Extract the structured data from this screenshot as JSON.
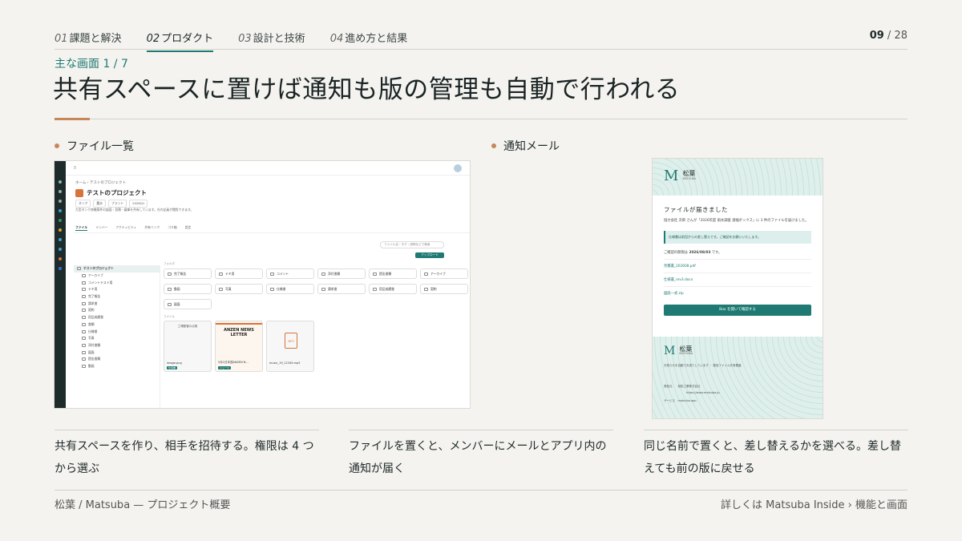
{
  "nav": {
    "items": [
      {
        "num": "01",
        "label": "課題と解決"
      },
      {
        "num": "02",
        "label": "プロダクト"
      },
      {
        "num": "03",
        "label": "設計と技術"
      },
      {
        "num": "04",
        "label": "進め方と結果"
      }
    ],
    "active_index": 1
  },
  "page": {
    "current": "09",
    "separator": "/",
    "total": "28"
  },
  "eyebrow": "主な画面 1 / 7",
  "title": "共有スペースに置けば通知も版の管理も自動で行われる",
  "sections": {
    "left_label": "ファイル一覧",
    "right_label": "通知メール"
  },
  "app": {
    "breadcrumb": "ホーム › テストのプロジェクト",
    "project_name": "テストのプロジェクト",
    "chips": [
      "タンク",
      "農水",
      "プラント",
      "2026Q1"
    ],
    "description": "大型タンク修繕案件の図面・見積・議事を共有しています。社内全員が閲覧できます。",
    "tabs": [
      "ファイル",
      "メンバー",
      "アクティビティ",
      "共有リンク",
      "ゴミ箱",
      "設定"
    ],
    "search_placeholder": "ファイル名・タグ・説明などで検索",
    "upload_label": "アップロード",
    "tree_root": "テストのプロジェクト",
    "tree": [
      "アーカイブ",
      "コメントテスト用",
      "テキ用",
      "完了報告",
      "請求書",
      "契約",
      "用品成績書",
      "書類",
      "仕様書",
      "写真",
      "添付書類",
      "図面",
      "提出書類",
      "動画"
    ],
    "folders_heading": "フォルダ",
    "folders": [
      "完了報告",
      "テキ用",
      "コメント",
      "添付書類",
      "提出書類",
      "アーカイブ",
      "動画",
      "写真",
      "仕様書",
      "請求書",
      "用品成績書",
      "契約",
      "図面"
    ],
    "files_heading": "ファイル",
    "files": [
      {
        "name": "image.png",
        "tag": "仕様書",
        "preview": "工場配管の点検"
      },
      {
        "name": "5月1日本週ANZEN N...",
        "tag": "ニュース",
        "preview": "ANZEN NEWS LETTER"
      },
      {
        "name": "music_19_12345.mp3",
        "tag": "",
        "preview": "MP3"
      }
    ]
  },
  "mail": {
    "brand": "松葉",
    "brand_en": "MATSUBA",
    "heading": "ファイルが届きました",
    "body": "協力会社 次郎 さんが「2026年度 雨水調査 道幅ボックス」に 3 件のファイルを届けました。",
    "note": "仕様書は前回からの差し替えです。ご確認をお願いいたします。",
    "due_prefix": "ご確認の期限は",
    "due_date": "2026/08/03",
    "due_suffix": "です。",
    "files": [
      "見積書_202608.pdf",
      "仕様書_rev3.docx",
      "図面一式.zip"
    ],
    "button": "Box を開いて確認する",
    "footer_note": "お知らせを自動でお送りしています ・ 配信ファイル共有基盤",
    "footer_company_label": "発信元",
    "footer_company": "松松工業株式会社",
    "footer_url": "https://www.matsuba.jp",
    "footer_service_label": "サービス",
    "footer_service": "matsuba.app"
  },
  "captions": [
    "共有スペースを作り、相手を招待する。権限は 4 つから選ぶ",
    "ファイルを置くと、メンバーにメールとアプリ内の通知が届く",
    "同じ名前で置くと、差し替えるかを選べる。差し替えても前の版に戻せる"
  ],
  "footer": {
    "left": "松葉 / Matsuba — プロジェクト概要",
    "right": "詳しくは Matsuba Inside › 機能と画面"
  },
  "colors": {
    "accent": "#1f7a73",
    "highlight": "#c7865a",
    "background": "#f4f3ef"
  }
}
